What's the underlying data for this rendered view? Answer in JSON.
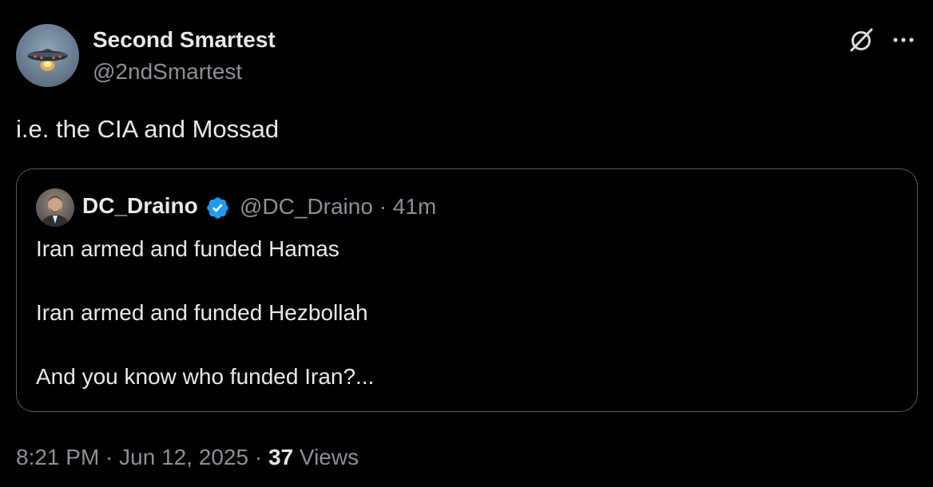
{
  "tweet": {
    "author": {
      "name": "Second Smartest",
      "handle": "@2ndSmartest"
    },
    "text": "i.e. the CIA and Mossad",
    "timestamp": "8:21 PM · Jun 12, 2025 · ",
    "views_count": "37",
    "views_label": " Views",
    "icons": {
      "grok": "grok-slash-circle-icon",
      "more": "more-horizontal-icon",
      "verified": "verified-badge-icon"
    }
  },
  "quote": {
    "author": {
      "name": "DC_Draino",
      "handle_time": "@DC_Draino · 41m"
    },
    "lines": [
      "Iran armed and funded Hamas",
      "Iran armed and funded Hezbollah",
      "And you know who funded Iran?..."
    ]
  },
  "colors": {
    "background": "#000000",
    "text_primary": "#e7e9ea",
    "text_secondary": "#8b9095",
    "border": "#55595e",
    "verified_blue": "#1d9bf0"
  }
}
